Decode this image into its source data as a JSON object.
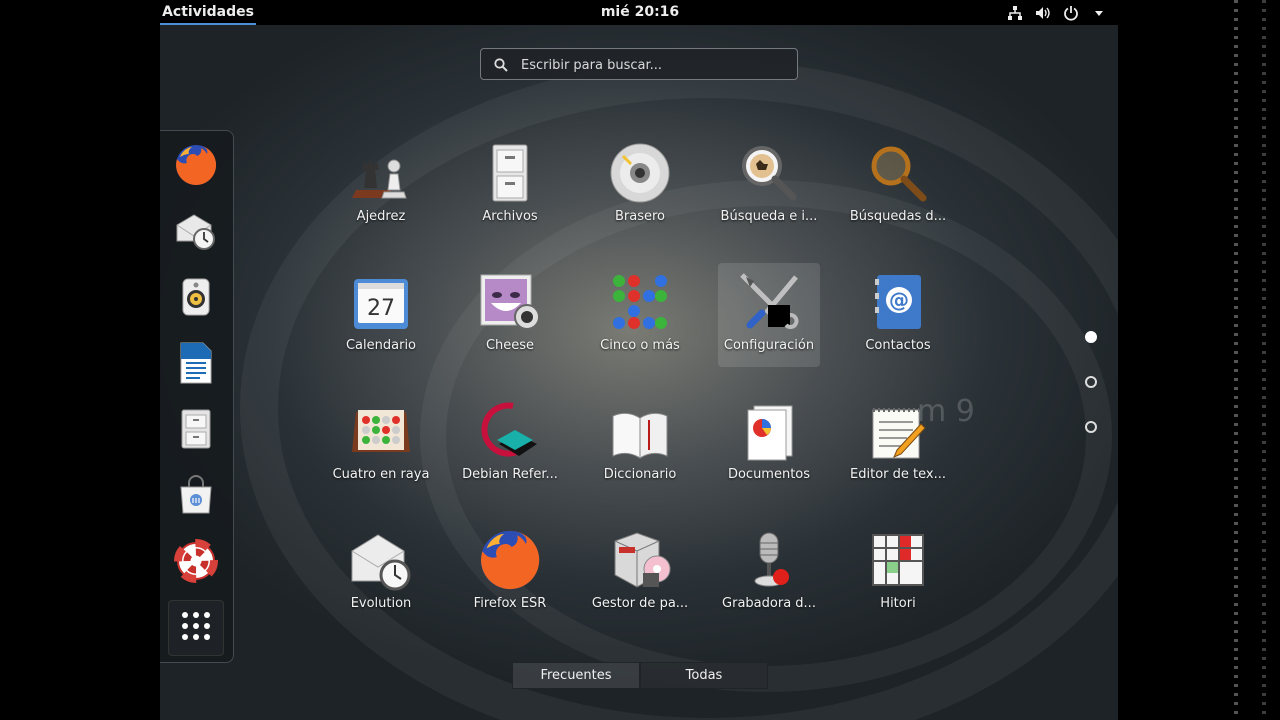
{
  "topbar": {
    "activities_label": "Actividades",
    "clock": "mié 20:16",
    "tray_icons": [
      "network-icon",
      "volume-icon",
      "power-icon",
      "chevron-down-icon"
    ]
  },
  "search": {
    "placeholder": "Escribir para buscar..."
  },
  "watermark": "m 9",
  "dash": {
    "items": [
      {
        "name": "firefox-icon"
      },
      {
        "name": "evolution-icon"
      },
      {
        "name": "rhythmbox-icon"
      },
      {
        "name": "libreoffice-writer-icon"
      },
      {
        "name": "files-icon"
      },
      {
        "name": "software-icon"
      },
      {
        "name": "help-icon"
      },
      {
        "name": "show-applications-icon"
      }
    ]
  },
  "apps": [
    {
      "label": "Ajedrez",
      "icon": "chess-icon"
    },
    {
      "label": "Archivos",
      "icon": "file-cabinet-icon"
    },
    {
      "label": "Brasero",
      "icon": "disc-icon"
    },
    {
      "label": "Búsqueda e i...",
      "icon": "search-paw-icon"
    },
    {
      "label": "Búsquedas d...",
      "icon": "magnifier-icon"
    },
    {
      "label": "Calendario",
      "icon": "calendar-icon",
      "day": "27"
    },
    {
      "label": "Cheese",
      "icon": "cheese-icon"
    },
    {
      "label": "Cinco o más",
      "icon": "five-or-more-icon"
    },
    {
      "label": "Configuración",
      "icon": "settings-tools-icon",
      "selected": true
    },
    {
      "label": "Contactos",
      "icon": "contacts-book-icon"
    },
    {
      "label": "Cuatro en raya",
      "icon": "four-in-a-row-icon"
    },
    {
      "label": "Debian Refer...",
      "icon": "debian-reference-icon"
    },
    {
      "label": "Diccionario",
      "icon": "dictionary-book-icon"
    },
    {
      "label": "Documentos",
      "icon": "documents-icon"
    },
    {
      "label": "Editor de tex...",
      "icon": "text-editor-icon"
    },
    {
      "label": "Evolution",
      "icon": "evolution-mail-icon"
    },
    {
      "label": "Firefox ESR",
      "icon": "firefox-icon"
    },
    {
      "label": "Gestor de pa...",
      "icon": "package-manager-icon"
    },
    {
      "label": "Grabadora d...",
      "icon": "microphone-icon"
    },
    {
      "label": "Hitori",
      "icon": "hitori-grid-icon"
    }
  ],
  "pages": {
    "count": 3,
    "current": 1
  },
  "tabs": [
    {
      "label": "Frecuentes",
      "active": true
    },
    {
      "label": "Todas",
      "active": false
    }
  ],
  "colors": {
    "accent": "#4a90d9",
    "topbar": "#000000",
    "firefox_orange": "#f26522",
    "firefox_blue": "#2b4db4"
  }
}
